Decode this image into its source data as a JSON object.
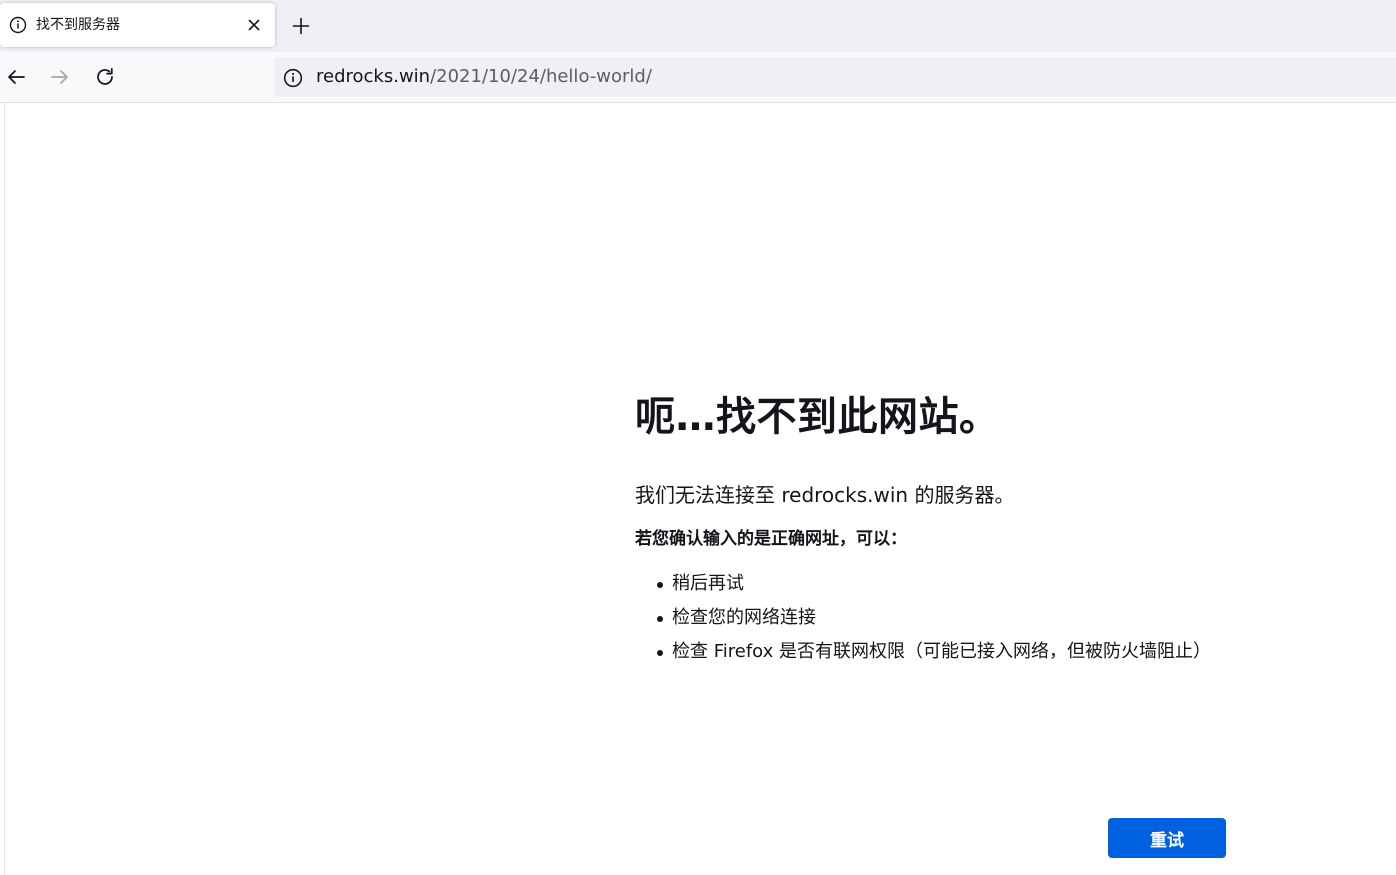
{
  "tab": {
    "title": "找不到服务器",
    "icon": "info-circle-icon",
    "close_icon": "close-icon"
  },
  "toolbar": {
    "new_tab_icon": "plus-icon",
    "back_icon": "back-arrow-icon",
    "forward_icon": "forward-arrow-icon",
    "reload_icon": "reload-icon"
  },
  "urlbar": {
    "host": "redrocks.win",
    "path": "/2021/10/24/hello-world/",
    "icon": "info-circle-icon"
  },
  "error": {
    "title": "呃…找不到此网站。",
    "description": "我们无法连接至 redrocks.win 的服务器。",
    "hint": "若您确认输入的是正确网址，可以：",
    "suggestions": [
      "稍后再试",
      "检查您的网络连接",
      "检查 Firefox 是否有联网权限（可能已接入网络，但被防火墙阻止）"
    ],
    "retry_label": "重试"
  },
  "colors": {
    "accent": "#0061e0",
    "tabstrip_bg": "#f0f0f4",
    "navbar_bg": "#f9f9fb",
    "text": "#15141a"
  }
}
